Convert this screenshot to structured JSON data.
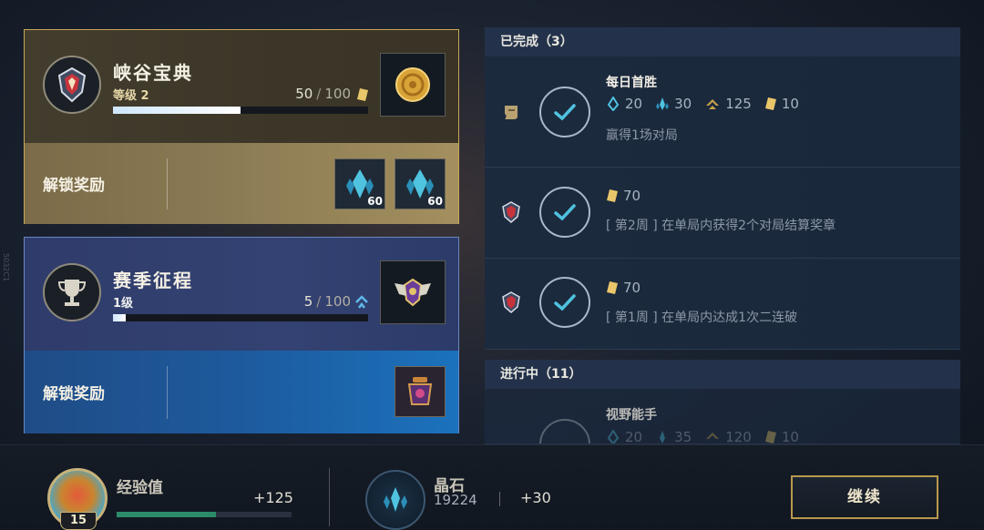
{
  "side_mark": "5032C1",
  "cards": [
    {
      "title": "峡谷宝典",
      "subtitle": "等级 2",
      "progress_current": "50",
      "progress_sep": "/",
      "progress_max": "100",
      "progress_fraction": 0.5,
      "unlock_label": "解锁奖励",
      "rewards": [
        {
          "icon": "blue-crystal-icon",
          "qty": "60"
        },
        {
          "icon": "blue-crystal-icon",
          "qty": "60"
        }
      ]
    },
    {
      "title": "赛季征程",
      "subtitle": "1级",
      "progress_current": "5",
      "progress_sep": "/",
      "progress_max": "100",
      "progress_fraction": 0.05,
      "unlock_label": "解锁奖励"
    }
  ],
  "completed": {
    "header": "已完成（3）",
    "missions": [
      {
        "title": "每日首胜",
        "rewards": [
          "20",
          "30",
          "125",
          "10"
        ],
        "desc": "赢得1场对局"
      },
      {
        "rewards": [
          "70"
        ],
        "desc": "[ 第2周 ] 在单局内获得2个对局结算奖章"
      },
      {
        "rewards": [
          "70"
        ],
        "desc": "[ 第1周 ] 在单局内达成1次二连破"
      }
    ]
  },
  "in_progress": {
    "header": "进行中（11）",
    "missions": [
      {
        "title": "视野能手",
        "rewards": [
          "20",
          "35",
          "120",
          "10"
        ]
      }
    ]
  },
  "bottom": {
    "level": "15",
    "xp_label": "经验值",
    "xp_gain": "+125",
    "xp_fraction": 0.57,
    "crystal_label": "晶石",
    "crystal_value": "19224",
    "crystal_gain": "+30",
    "continue_label": "继续"
  },
  "colors": {
    "gold_accent": "#c9a656",
    "blue_accent": "#6a86c4",
    "crystal_blue": "#4fc3e0",
    "token_gold": "#e9c66a"
  }
}
